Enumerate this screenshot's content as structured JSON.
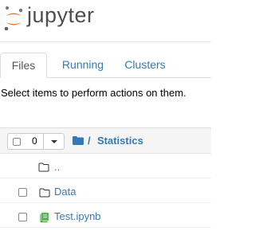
{
  "header": {
    "logo_text": "jupyter"
  },
  "tabs": [
    {
      "label": "Files",
      "active": true
    },
    {
      "label": "Running",
      "active": false
    },
    {
      "label": "Clusters",
      "active": false
    }
  ],
  "hint_text": "Select items to perform actions on them.",
  "toolbar": {
    "selected_count": "0"
  },
  "breadcrumb": {
    "separator": "/",
    "current": "Statistics"
  },
  "files": [
    {
      "name": "..",
      "type": "folder"
    },
    {
      "name": "Data",
      "type": "folder"
    },
    {
      "name": "Test.ipynb",
      "type": "notebook"
    }
  ],
  "colors": {
    "link": "#337ab7",
    "notebook_icon": "#5cb85c",
    "logo_orange": "#f37726",
    "logo_gray": "#616161"
  }
}
